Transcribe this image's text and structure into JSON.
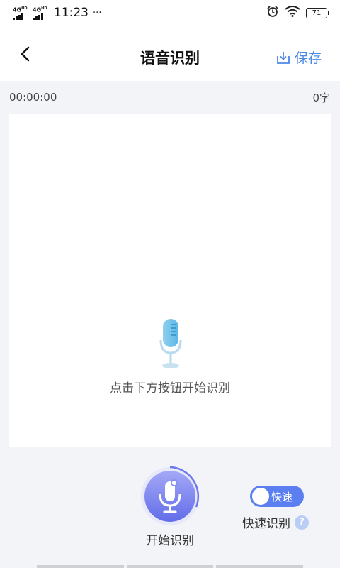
{
  "status_bar": {
    "network1": "4G",
    "network1_sup": "HD",
    "network2": "4G",
    "network2_sup": "HD",
    "time": "11:23",
    "more": "···",
    "battery": "71"
  },
  "header": {
    "back_icon": "chevron-left-icon",
    "title": "语音识别",
    "save_icon": "download-icon",
    "save_label": "保存"
  },
  "info": {
    "duration": "00:00:00",
    "char_count": "0字"
  },
  "text_area": {
    "hint": "点击下方按钮开始识别",
    "illustration_icon": "microphone-icon"
  },
  "controls": {
    "record_label": "开始识别",
    "record_icon": "microphone-icon",
    "toggle_text": "快速",
    "toggle_on": true,
    "fast_label": "快速识别",
    "help_symbol": "?"
  },
  "colors": {
    "accent": "#4a89e8",
    "toggle": "#5b7ef0",
    "record_gradient_start": "#9a9ff5",
    "record_gradient_end": "#6570e9",
    "background": "#f3f4f8"
  }
}
